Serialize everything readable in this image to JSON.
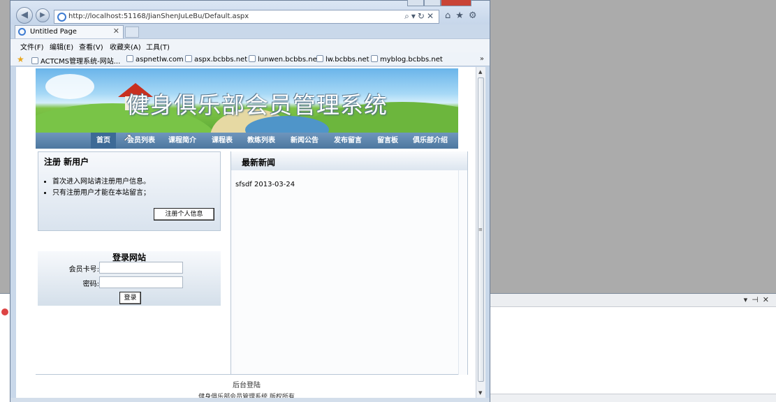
{
  "browser": {
    "url": "http://localhost:51168/JianShenJuLeBu/Default.aspx",
    "tab_title": "Untitled Page",
    "menu": [
      "文件(F)",
      "编辑(E)",
      "查看(V)",
      "收藏夹(A)",
      "工具(T)"
    ],
    "favorites": [
      "ACTCMS管理系统-网站...",
      "aspnetlw.com",
      "aspx.bcbbs.net",
      "lunwen.bcbbs.net",
      "lw.bcbbs.net",
      "myblog.bcbbs.net"
    ]
  },
  "page": {
    "banner_title": "健身俱乐部会员管理系统",
    "nav": [
      "首页",
      "会员列表",
      "课程简介",
      "课程表",
      "教练列表",
      "新闻公告",
      "发布留言",
      "留言板",
      "俱乐部介绍"
    ],
    "register": {
      "heading": "注册  新用户",
      "bullets": [
        "首次进入网站请注册用户信息。",
        "只有注册用户才能在本站留言；"
      ],
      "button": "注册个人信息"
    },
    "login": {
      "heading": "登录网站",
      "card_label": "会员卡号:",
      "password_label": "密码:",
      "button": "登录"
    },
    "news": {
      "heading": "最新新闻",
      "items": [
        {
          "title": "sfsdf",
          "date": "2013-03-24"
        }
      ]
    },
    "footer": {
      "admin_link": "后台登陆",
      "copyright": "健身俱乐部会员管理系统 版权所有"
    }
  }
}
